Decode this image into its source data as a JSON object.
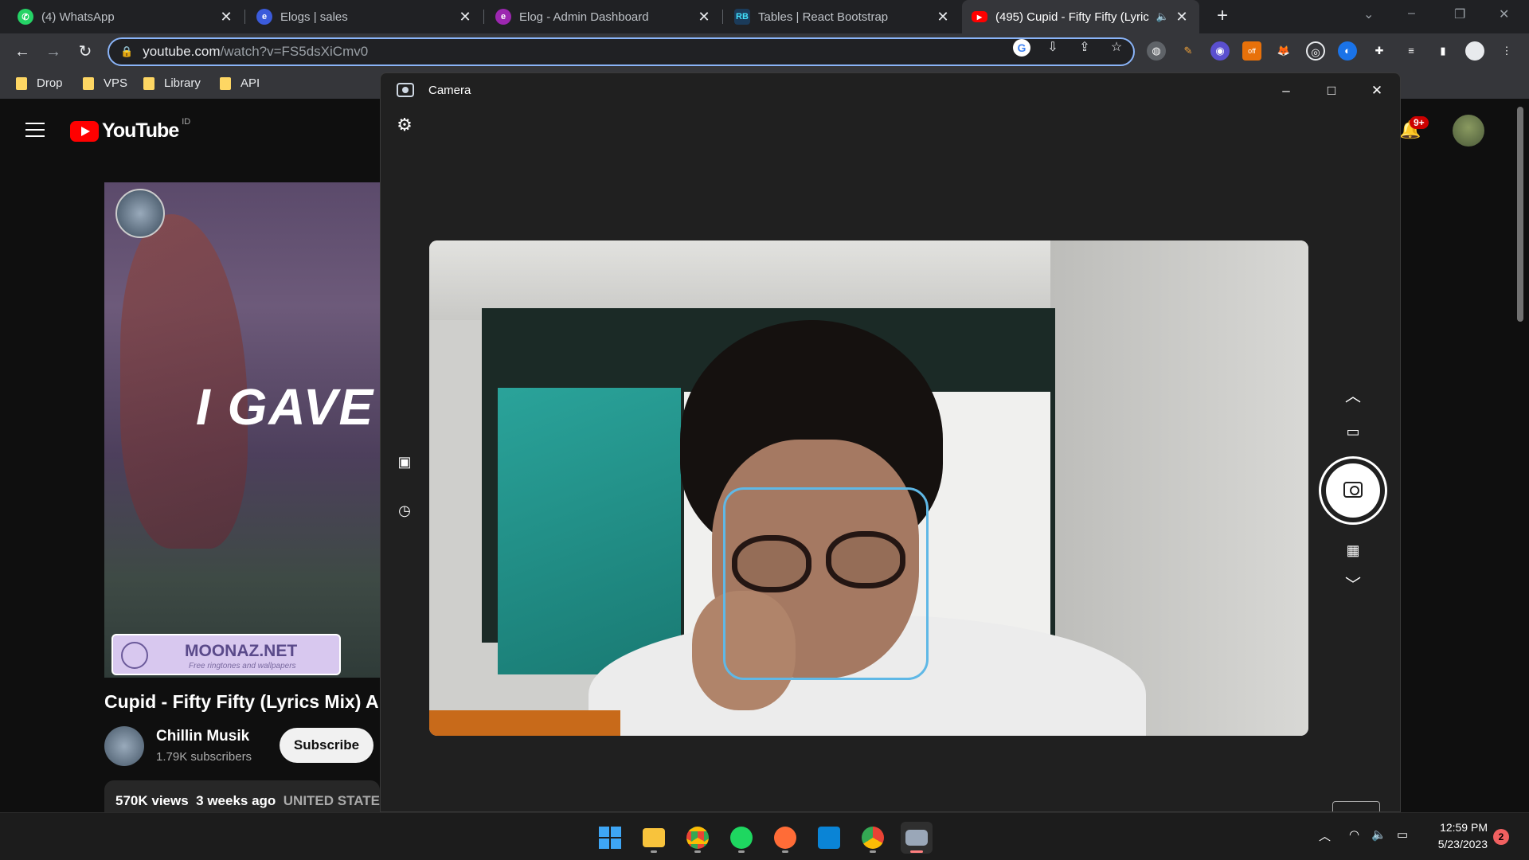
{
  "browser": {
    "tabs": [
      {
        "title": "(4) WhatsApp",
        "favicon": "whatsapp-icon",
        "color": "#25d366"
      },
      {
        "title": "Elogs | sales",
        "favicon": "elogs-icon",
        "color": "#3b5bdb"
      },
      {
        "title": "Elog - Admin Dashboard",
        "favicon": "elog-admin-icon",
        "color": "#9c27b0"
      },
      {
        "title": "Tables | React Bootstrap",
        "favicon": "react-bootstrap-icon",
        "color": "#41e0fd"
      },
      {
        "title": "(495) Cupid - Fifty Fifty (Lyric",
        "favicon": "youtube-icon",
        "color": "#ff0000"
      }
    ],
    "new_tab": "+",
    "url_host": "youtube.com",
    "url_path": "/watch?v=FS5dsXiCmv0",
    "bookmarks": [
      "Drop",
      "VPS",
      "Library",
      "API"
    ],
    "extension_badge": "off"
  },
  "youtube": {
    "logo_text": "YouTube",
    "country_code": "ID",
    "notification_badge": "9+",
    "video_overlay_text": "I GAVE A",
    "watermark_name": "MOONAZ.NET",
    "watermark_tagline": "Free ringtones and wallpapers",
    "video_title": "Cupid - Fifty Fifty (Lyrics Mix) An",
    "channel_name": "Chillin Musik",
    "subscribers": "1.79K subscribers",
    "subscribe_label": "Subscribe",
    "views": "570K views",
    "age": "3 weeks ago",
    "country": "UNITED STATES"
  },
  "camera": {
    "title": "Camera",
    "minimize": "–",
    "maximize": "□",
    "close": "✕"
  },
  "taskbar": {
    "apps": [
      "start-icon",
      "file-explorer-icon",
      "chrome-icon",
      "spotify-icon",
      "postman-icon",
      "vscode-icon",
      "chrome-profile-icon",
      "camera-app-icon"
    ],
    "time": "12:59 PM",
    "date": "5/23/2023",
    "notification_count": "2"
  },
  "colors": {
    "accent": "#8ab4f8",
    "youtube_red": "#ff0000",
    "face_box": "#5fb8e6"
  }
}
